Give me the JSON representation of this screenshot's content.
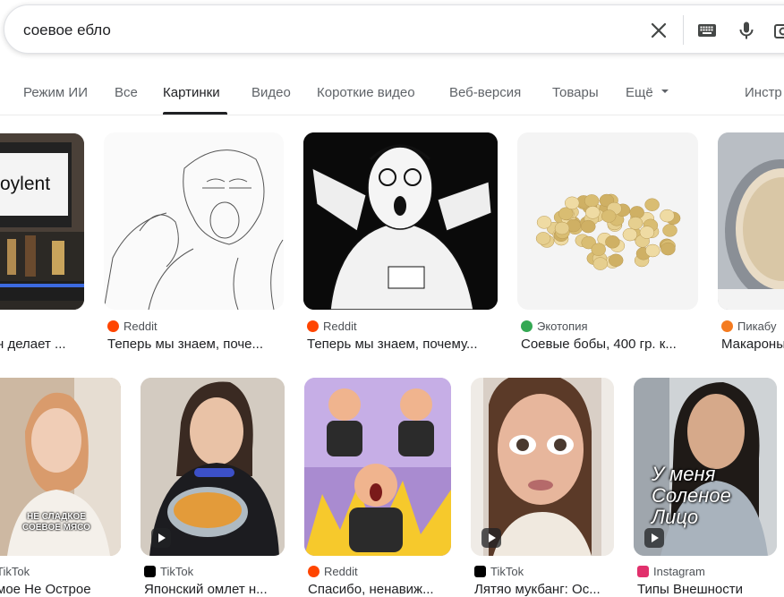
{
  "search": {
    "query": "соевое ебло"
  },
  "tabs": [
    {
      "label": "Режим ИИ"
    },
    {
      "label": "Все"
    },
    {
      "label": "Картинки"
    },
    {
      "label": "Видео"
    },
    {
      "label": "Короткие видео"
    },
    {
      "label": "Веб-версия"
    },
    {
      "label": "Товары"
    },
    {
      "label": "Ещё"
    },
    {
      "label": "Инстр"
    }
  ],
  "results": [
    {
      "source": "",
      "title": "н делает ...",
      "overlay": "oylent"
    },
    {
      "source": "Reddit",
      "title": "Теперь мы знаем, поче..."
    },
    {
      "source": "Reddit",
      "title": "Теперь мы знаем, почему..."
    },
    {
      "source": "Экотопия",
      "title": "Соевые бобы, 400 гр. к..."
    },
    {
      "source": "Пикабу",
      "title": "Макароны"
    },
    {
      "source": "TikTok",
      "title": "мое Не Острое",
      "overlay": "НЕ СЛАДКОЕ\nСОЕВОЕ МЯСО"
    },
    {
      "source": "TikTok",
      "title": "Японский омлет н..."
    },
    {
      "source": "Reddit",
      "title": "Спасибо, ненавиж..."
    },
    {
      "source": "TikTok",
      "title": "Лятяо мукбанг: Ос..."
    },
    {
      "source": "Instagram",
      "title": "Типы Внешности",
      "overlay": "У меня Соленое Лицо"
    }
  ],
  "colors": {
    "reddit": "#ff4500",
    "tiktok": "#000000",
    "ecotopia": "#34a853",
    "pikabu": "#f47b20",
    "instagram": "#e1306c"
  },
  "icons": [
    "close-icon",
    "keyboard-icon",
    "microphone-icon",
    "camera-icon",
    "chevron-down-icon",
    "play-icon"
  ]
}
